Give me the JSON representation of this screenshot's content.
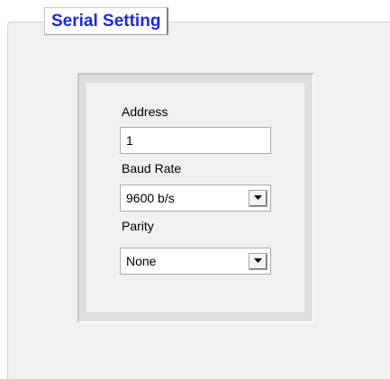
{
  "panel": {
    "tab_title": "Serial Setting"
  },
  "form": {
    "address": {
      "label": "Address",
      "value": "1"
    },
    "baud_rate": {
      "label": "Baud Rate",
      "selected": "9600 b/s",
      "dropdown_icon": "chevron-down-icon"
    },
    "parity": {
      "label": "Parity",
      "selected": "None",
      "dropdown_icon": "chevron-down-icon"
    }
  },
  "colors": {
    "tab_text": "#1e28dc",
    "panel_background": "#f0f0f0"
  }
}
